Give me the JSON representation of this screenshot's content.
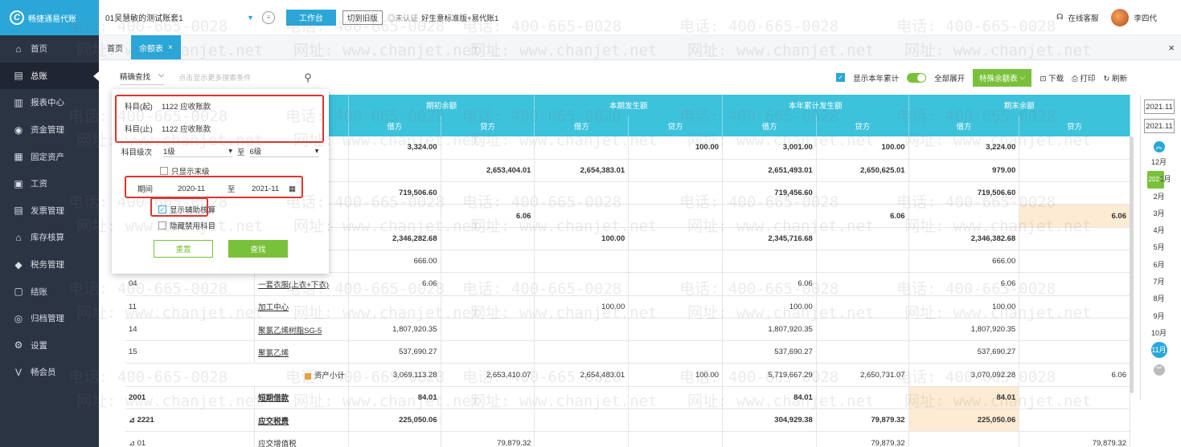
{
  "brand": {
    "name": "畅捷通易代账",
    "mark": "C"
  },
  "sidebar": {
    "items": [
      {
        "label": "首页",
        "icon": "⌂",
        "active": false
      },
      {
        "label": "总账",
        "icon": "▤",
        "active": true
      },
      {
        "label": "报表中心",
        "icon": "▥",
        "active": false
      },
      {
        "label": "资金管理",
        "icon": "◉",
        "active": false
      },
      {
        "label": "固定资产",
        "icon": "▦",
        "active": false
      },
      {
        "label": "工资",
        "icon": "▣",
        "active": false
      },
      {
        "label": "发票管理",
        "icon": "▤",
        "active": false
      },
      {
        "label": "库存核算",
        "icon": "⌂",
        "active": false
      },
      {
        "label": "税务管理",
        "icon": "◆",
        "active": false
      },
      {
        "label": "结账",
        "icon": "▢",
        "active": false
      },
      {
        "label": "归档管理",
        "icon": "◎",
        "active": false
      },
      {
        "label": "设置",
        "icon": "⚙",
        "active": false
      },
      {
        "label": "畅会员",
        "icon": "V",
        "active": false
      }
    ]
  },
  "topbar": {
    "account": "01吴慧敏的测试账套1",
    "workbench": "工作台",
    "switch_old": "切到旧版",
    "cert": "◎未认证",
    "edition": "好生意标准版+易代账1",
    "support": "在线客服",
    "user": "李四代"
  },
  "tabs": [
    {
      "label": "首页",
      "active": false
    },
    {
      "label": "余额表",
      "active": true
    }
  ],
  "tab_close": "×",
  "toolbar": {
    "precise_search": "精确查找",
    "search_placeholder": "点击显示更多搜索条件",
    "show_year_total": "显示本年累计",
    "expand_all": "全部展开",
    "special_balance": "特殊余额表",
    "download": "下载",
    "print": "打印",
    "refresh": "刷新"
  },
  "filter": {
    "subject_from_label": "科目(起)",
    "subject_from": "1122 应收账款",
    "subject_to_label": "科目(止)",
    "subject_to": "1122 应收账款",
    "level_label": "科目级次",
    "level_from": "1级",
    "level_sep": "至",
    "level_to": "6级",
    "only_last_level": "只显示末级",
    "period_label": "期间",
    "period_from": "2020-11",
    "period_sep": "至",
    "period_to": "2021-11",
    "show_aux": "显示辅助核算",
    "hide_disabled": "隐藏禁用科目",
    "reset": "重置",
    "find": "查找"
  },
  "table": {
    "group_headers": [
      "期初余额",
      "本期发生额",
      "本年累计发生额",
      "期末余额"
    ],
    "sub_headers": [
      "借方",
      "贷方",
      "借方",
      "贷方",
      "借方",
      "贷方",
      "借方",
      "贷方"
    ],
    "rows": [
      {
        "code": "",
        "name": "",
        "bold": true,
        "cells": [
          "3,324.00",
          "",
          "",
          "100.00",
          "3,001.00",
          "100.00",
          "3,224.00",
          ""
        ],
        "hl": []
      },
      {
        "code": "",
        "name": "",
        "bold": true,
        "cells": [
          "",
          "2,653,404.01",
          "2,654,383.01",
          "",
          "2,651,493.01",
          "2,650,625.01",
          "979.00",
          ""
        ],
        "hl": []
      },
      {
        "code": "",
        "name": "",
        "bold": true,
        "cells": [
          "719,506.60",
          "",
          "",
          "",
          "719,456.60",
          "",
          "719,506.60",
          ""
        ],
        "hl": []
      },
      {
        "code": "",
        "name": "",
        "bold": true,
        "cells": [
          "",
          "6.06",
          "",
          "",
          "",
          "6.06",
          "",
          "6.06"
        ],
        "hl": [
          7
        ]
      },
      {
        "code": "",
        "name": "",
        "bold": true,
        "cells": [
          "2,346,282.68",
          "",
          "100.00",
          "",
          "2,345,716.68",
          "",
          "2,346,382.68",
          ""
        ],
        "hl": []
      },
      {
        "code": "",
        "name": "",
        "bold": false,
        "cells": [
          "666.00",
          "",
          "",
          "",
          "",
          "",
          "666.00",
          ""
        ],
        "hl": []
      },
      {
        "code": "04",
        "name": "一套衣服(上衣+下衣)",
        "bold": false,
        "link": true,
        "cells": [
          "6.06",
          "",
          "",
          "",
          "6.06",
          "",
          "6.06",
          ""
        ],
        "hl": []
      },
      {
        "code": "11",
        "name": "加工中心",
        "bold": false,
        "link": true,
        "cells": [
          "",
          "",
          "100.00",
          "",
          "100.00",
          "",
          "100.00",
          ""
        ],
        "hl": []
      },
      {
        "code": "14",
        "name": "聚氯乙烯树脂SG-5",
        "bold": false,
        "link": true,
        "cells": [
          "1,807,920.35",
          "",
          "",
          "",
          "1,807,920.35",
          "",
          "1,807,920.35",
          ""
        ],
        "hl": []
      },
      {
        "code": "15",
        "name": "聚氯乙烯",
        "bold": false,
        "link": true,
        "cells": [
          "537,690.27",
          "",
          "",
          "",
          "537,690.27",
          "",
          "537,690.27",
          ""
        ],
        "hl": []
      },
      {
        "code": "",
        "name": "资产小计",
        "bold": false,
        "subtotal": true,
        "cells": [
          "3,069,113.28",
          "2,653,410.07",
          "2,654,483.01",
          "100.00",
          "5,719,667.29",
          "2,650,731.07",
          "3,070,092.28",
          "6.06"
        ],
        "hl": []
      },
      {
        "code": "2001",
        "name": "短期借款",
        "bold": true,
        "link": true,
        "cells": [
          "84.01",
          "",
          "",
          "",
          "84.01",
          "",
          "84.01",
          ""
        ],
        "hl": [
          6
        ]
      },
      {
        "code": "⊿ 2221",
        "name": "应交税费",
        "bold": true,
        "link": true,
        "cells": [
          "225,050.06",
          "",
          "",
          "",
          "304,929.38",
          "79,879.32",
          "225,050.06",
          ""
        ],
        "hl": [
          6
        ]
      },
      {
        "code": "⊿ 01",
        "name": "应交增值税",
        "bold": false,
        "link": true,
        "cells": [
          "",
          "79,879.32",
          "",
          "",
          "",
          "79,879.32",
          "",
          "79,879.32"
        ],
        "hl": []
      }
    ]
  },
  "period_panel": {
    "from": "2021.11",
    "to": "2021.11",
    "year_tag": "2021",
    "months": [
      "12月",
      "1月",
      "2月",
      "3月",
      "4月",
      "5月",
      "6月",
      "7月",
      "8月",
      "9月",
      "10月",
      "11月"
    ],
    "current": "11月"
  },
  "watermarks": {
    "phone": "电话: 400-665-0028",
    "site": "网址: www.chanjet.net"
  }
}
